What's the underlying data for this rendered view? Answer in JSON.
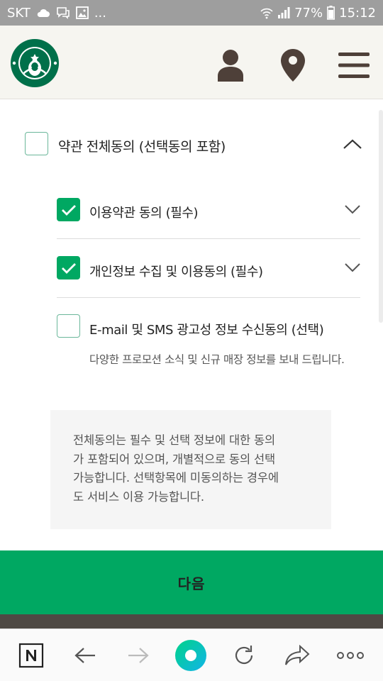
{
  "status_bar": {
    "carrier": "SKT",
    "dots": "...",
    "battery": "77%",
    "time": "15:12"
  },
  "header": {
    "logo": "starbucks-siren-logo",
    "icons": [
      "user-icon",
      "store-location-icon",
      "hamburger-menu-icon"
    ]
  },
  "agreement": {
    "all": {
      "label": "약관 전체동의 (선택동의 포함)",
      "checked": false,
      "expanded": true
    },
    "items": [
      {
        "label": "이용약관 동의 (필수)",
        "checked": true
      },
      {
        "label": "개인정보 수집 및 이용동의 (필수)",
        "checked": true
      },
      {
        "label": "E-mail 및 SMS 광고성 정보 수신동의 (선택)",
        "checked": false,
        "description": "다양한 프로모션 소식 및 신규 매장 정보를 보내 드립니다."
      }
    ]
  },
  "notice": {
    "lines": [
      "전체동의는 필수 및 선택 정보에 대한 동의",
      "가 포함되어 있으며, 개별적으로 동의 선택",
      "가능합니다. 선택항목에 미동의하는 경우에",
      "도 서비스 이용 가능합니다."
    ]
  },
  "next_button": {
    "label": "다음"
  },
  "colors": {
    "accent": "#00a862",
    "status_bar": "#9e9e9e",
    "header_bg": "#f6f5f0",
    "icon_brown": "#4e4039"
  },
  "browser_bar": {
    "icons": [
      "naver-n-icon",
      "back-arrow-icon",
      "forward-arrow-icon",
      "home-circle-icon",
      "refresh-icon",
      "share-icon",
      "more-icon"
    ]
  }
}
